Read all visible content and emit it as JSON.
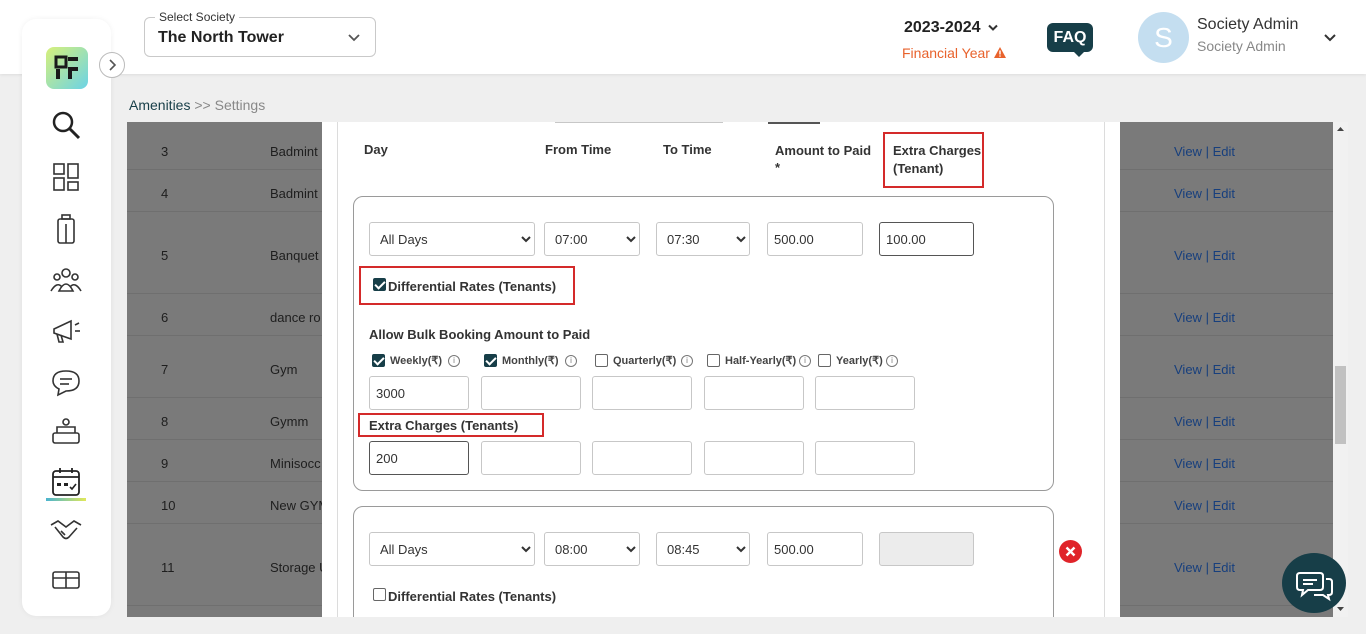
{
  "header": {
    "society_label": "Select Society",
    "society_value": "The North Tower",
    "financial_year": "2023-2024",
    "financial_year_label": "Financial Year",
    "faq": "FAQ",
    "avatar_letter": "S",
    "user_name": "Society Admin",
    "user_role": "Society Admin"
  },
  "sidebar": {
    "items": [
      "search-icon",
      "dashboard-icon",
      "building-icon",
      "members-icon",
      "announcement-icon",
      "chat-icon",
      "services-icon",
      "calendar-icon",
      "handshake-icon",
      "box-icon"
    ]
  },
  "breadcrumb": {
    "parent": "Amenities",
    "separator": ">>",
    "current": "Settings"
  },
  "table": {
    "rows": [
      {
        "num": "3",
        "name": "Badmint",
        "action_view": "View",
        "action_sep": "|",
        "action_edit": "Edit"
      },
      {
        "num": "4",
        "name": "Badmint",
        "action_view": "View",
        "action_sep": "|",
        "action_edit": "Edit"
      },
      {
        "num": "5",
        "name": "Banquet",
        "action_view": "View",
        "action_sep": "|",
        "action_edit": "Edit"
      },
      {
        "num": "6",
        "name": "dance ro",
        "action_view": "View",
        "action_sep": "|",
        "action_edit": "Edit"
      },
      {
        "num": "7",
        "name": "Gym",
        "action_view": "View",
        "action_sep": "|",
        "action_edit": "Edit"
      },
      {
        "num": "8",
        "name": "Gymm",
        "action_view": "View",
        "action_sep": "|",
        "action_edit": "Edit"
      },
      {
        "num": "9",
        "name": "Minisocc",
        "action_view": "View",
        "action_sep": "|",
        "action_edit": "Edit"
      },
      {
        "num": "10",
        "name": "New GYM",
        "action_view": "View",
        "action_sep": "|",
        "action_edit": "Edit"
      },
      {
        "num": "11",
        "name": "Storage U",
        "action_view": "View",
        "action_sep": "|",
        "action_edit": "Edit"
      }
    ]
  },
  "modal": {
    "columns": {
      "day": "Day",
      "from_time": "From Time",
      "to_time": "To Time",
      "amount_line1": "Amount to Paid",
      "amount_line2": "*",
      "extra_line1": "Extra Charges",
      "extra_line2": "(Tenant)"
    },
    "slot1": {
      "day": "All Days",
      "from": "07:00",
      "to": "07:30",
      "amount": "500.00",
      "extra": "100.00",
      "differential_label": "Differential Rates (Tenants)",
      "bulk_label": "Allow Bulk Booking Amount to Paid",
      "periods": [
        {
          "label": "Weekly(₹)",
          "checked": true,
          "value": "3000",
          "extra": "200"
        },
        {
          "label": "Monthly(₹)",
          "checked": true,
          "value": "",
          "extra": ""
        },
        {
          "label": "Quarterly(₹)",
          "checked": false,
          "value": "",
          "extra": ""
        },
        {
          "label": "Half-Yearly(₹)",
          "checked": false,
          "value": "",
          "extra": ""
        },
        {
          "label": "Yearly(₹)",
          "checked": false,
          "value": "",
          "extra": ""
        }
      ],
      "extra_charges_label": "Extra Charges (Tenants)"
    },
    "slot2": {
      "day": "All Days",
      "from": "08:00",
      "to": "08:45",
      "amount": "500.00",
      "extra": "",
      "differential_label": "Differential Rates (Tenants)"
    },
    "info_glyph": "i"
  },
  "colors": {
    "brand": "#173e48",
    "accent": "#e8622c",
    "danger": "#d42a2a"
  }
}
